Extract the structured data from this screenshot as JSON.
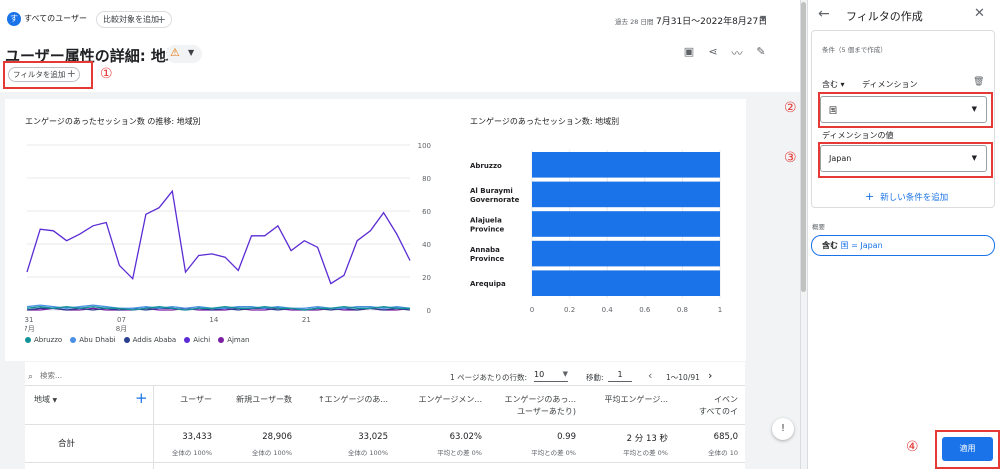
{
  "topbar": {
    "segment_badge": "す",
    "segment_label": "すべてのユーザー",
    "compare_chip": "比較対象を追加",
    "date_prefix": "過去 28 日間",
    "date_range": "7月31日～2022年8月27日"
  },
  "header": {
    "title": "ユーザー属性の詳細: 地域",
    "filter_chip": "フィルタを追加"
  },
  "annotations": {
    "m1": "①",
    "m2": "②",
    "m3": "③",
    "m4": "④"
  },
  "charts": {
    "line_title": "エンゲージのあったセッション数 の推移: 地域別",
    "bar_title": "エンゲージのあったセッション数: 地域別"
  },
  "chart_data": [
    {
      "type": "line",
      "title": "エンゲージのあったセッション数 の推移: 地域別",
      "x_tick_labels": [
        "31\n7月",
        "07\n8月",
        "14",
        "21"
      ],
      "ylim": [
        0,
        100
      ],
      "y_ticks": [
        0,
        20,
        40,
        60,
        80,
        100
      ],
      "series": [
        {
          "name": "Aichi",
          "color": "#5b2bd4",
          "values": [
            23,
            49,
            48,
            42,
            46,
            51,
            53,
            27,
            19,
            58,
            62,
            72,
            23,
            33,
            34,
            32,
            24,
            45,
            45,
            51,
            36,
            42,
            38,
            16,
            21,
            42,
            48,
            59,
            46,
            30
          ]
        },
        {
          "name": "Abruzzo",
          "color": "#12939a",
          "values": [
            1,
            2,
            1,
            2,
            1,
            2,
            1,
            1,
            0,
            1,
            2,
            1,
            0,
            1,
            1,
            2,
            1,
            1,
            2,
            1,
            1,
            0,
            1,
            1,
            2,
            1,
            1,
            2,
            1,
            1
          ]
        },
        {
          "name": "Abu Dhabi",
          "color": "#4a90e2",
          "values": [
            2,
            3,
            2,
            1,
            2,
            3,
            2,
            1,
            1,
            2,
            1,
            2,
            1,
            2,
            1,
            1,
            2,
            2,
            1,
            2,
            1,
            1,
            2,
            1,
            1,
            2,
            2,
            1,
            2,
            1
          ]
        },
        {
          "name": "Addis Ababa",
          "color": "#2c3e90",
          "values": [
            0,
            1,
            1,
            0,
            1,
            0,
            1,
            0,
            1,
            0,
            1,
            1,
            0,
            1,
            0,
            1,
            0,
            1,
            1,
            0,
            1,
            0,
            1,
            0,
            1,
            0,
            1,
            0,
            1,
            0
          ]
        },
        {
          "name": "Ajman",
          "color": "#7b1fa2",
          "values": [
            0,
            0,
            1,
            0,
            0,
            1,
            0,
            0,
            0,
            1,
            0,
            0,
            1,
            0,
            0,
            0,
            1,
            0,
            0,
            1,
            0,
            0,
            0,
            1,
            0,
            0,
            1,
            0,
            0,
            1
          ]
        }
      ]
    },
    {
      "type": "bar",
      "orientation": "horizontal",
      "title": "エンゲージのあったセッション数: 地域別",
      "categories": [
        "Abruzzo",
        "Al Buraymi Governorate",
        "Alajuela Province",
        "Annaba Province",
        "Arequipa"
      ],
      "category_lines": [
        [
          "Abruzzo"
        ],
        [
          "Al Buraymi",
          "Governorate"
        ],
        [
          "Alajuela",
          "Province"
        ],
        [
          "Annaba",
          "Province"
        ],
        [
          "Arequipa"
        ]
      ],
      "values": [
        1,
        1,
        1,
        1,
        1
      ],
      "xlim": [
        0,
        1
      ],
      "x_ticks": [
        "0",
        "0.2",
        "0.4",
        "0.6",
        "0.8",
        "1"
      ],
      "color": "#1a73e8"
    }
  ],
  "table": {
    "search_placeholder": "検索...",
    "rows_label": "1 ページあたりの行数:",
    "rows_value": "10",
    "goto_label": "移動:",
    "goto_value": "1",
    "pager_text": "1～10/91",
    "dim_header": "地域",
    "columns": [
      {
        "h1": "ユーザー",
        "h2": "",
        "total": "33,433",
        "sub": "全体の 100%"
      },
      {
        "h1": "新規ユーザー数",
        "h2": "",
        "total": "28,906",
        "sub": "全体の 100%"
      },
      {
        "h1": "↑エンゲージのあ...",
        "h2": "",
        "total": "33,025",
        "sub": "全体の 100%"
      },
      {
        "h1": "エンゲージメン...",
        "h2": "",
        "total": "63.02%",
        "sub": "平均との差 0%"
      },
      {
        "h1": "エンゲージのあっ...",
        "h2": "ユーザーあたり)",
        "total": "0.99",
        "sub": "平均との差 0%"
      },
      {
        "h1": "平均エンゲージ...",
        "h2": "",
        "total": "2 分 13 秒",
        "sub": "平均との差 0%"
      },
      {
        "h1": "イベン",
        "h2": "すべてのイ",
        "total": "685,0",
        "sub": "全体の 10"
      }
    ],
    "total_label": "合計"
  },
  "panel": {
    "title": "フィルタの作成",
    "cond_caption": "条件（5 個まで作成）",
    "include": "含む ▾",
    "dimension_label": "ディメンション",
    "dimension_value": "国",
    "value_label": "ディメンションの値",
    "value_value": "Japan",
    "add_condition": "新しい条件を追加",
    "summary_label": "概要",
    "summary_key": "含む",
    "summary_value": "国 = Japan",
    "apply": "適用"
  }
}
